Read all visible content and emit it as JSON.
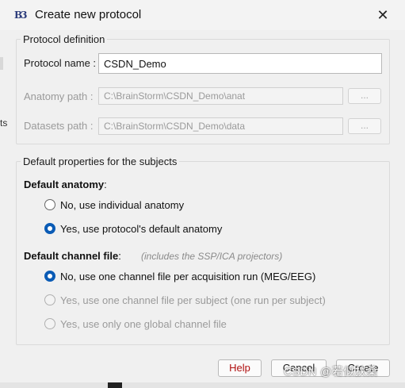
{
  "window": {
    "title": "Create new protocol",
    "app_icon_text": "B3",
    "close_glyph": "✕"
  },
  "left_edge_text": "ts",
  "protocol_definition": {
    "legend": "Protocol definition",
    "protocol_name": {
      "label": "Protocol name :",
      "value": "CSDN_Demo"
    },
    "anatomy_path": {
      "label": "Anatomy path :",
      "value": "C:\\BrainStorm\\CSDN_Demo\\anat",
      "browse": "..."
    },
    "datasets_path": {
      "label": "Datasets path :",
      "value": "C:\\BrainStorm\\CSDN_Demo\\data",
      "browse": "..."
    }
  },
  "defaults": {
    "legend": "Default properties for the subjects",
    "anatomy": {
      "heading": "Default anatomy",
      "heading_suffix": ":",
      "options": [
        {
          "label": "No, use individual anatomy",
          "selected": false,
          "enabled": true
        },
        {
          "label": "Yes, use protocol's default anatomy",
          "selected": true,
          "enabled": true
        }
      ]
    },
    "channel": {
      "heading": "Default channel file",
      "heading_suffix": ":",
      "hint": "(includes the SSP/ICA projectors)",
      "options": [
        {
          "label": "No, use one channel file per acquisition run (MEG/EEG)",
          "selected": true,
          "enabled": true
        },
        {
          "label": "Yes, use one channel file per subject  (one run per subject)",
          "selected": false,
          "enabled": false
        },
        {
          "label": "Yes, use only one global channel file",
          "selected": false,
          "enabled": false
        }
      ]
    }
  },
  "buttons": {
    "help": "Help",
    "cancel": "Cancel",
    "create": "Create"
  },
  "watermark": "CSDN @若似扶桑",
  "colors": {
    "accent": "#0a5bb5",
    "help_text": "#b01010",
    "disabled_text": "#9a9a9a"
  }
}
